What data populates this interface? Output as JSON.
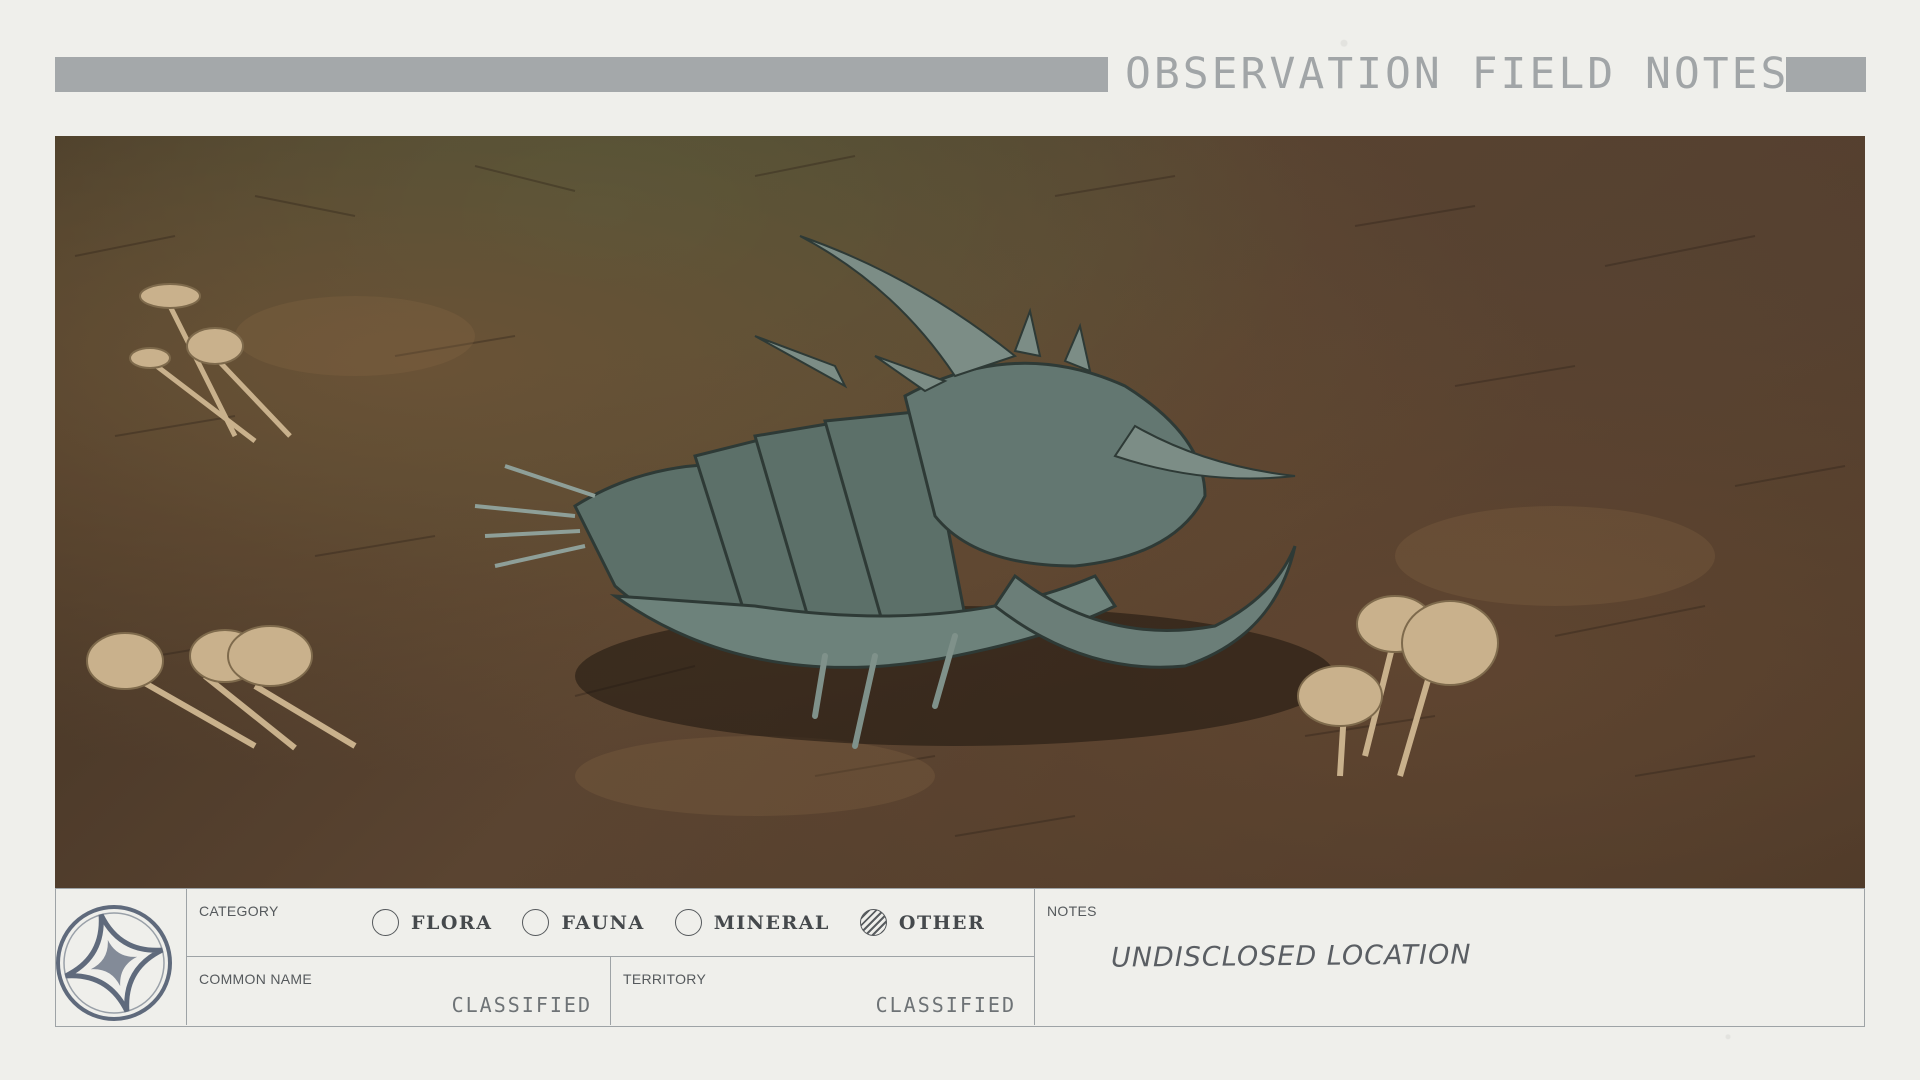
{
  "header": {
    "title": "OBSERVATION FIELD NOTES"
  },
  "photo": {
    "subject": ""
  },
  "info_panel": {
    "logo_icon": "four-point-star-emblem-icon",
    "category": {
      "label": "CATEGORY",
      "options": [
        {
          "label": "FLORA",
          "selected": false
        },
        {
          "label": "FAUNA",
          "selected": false
        },
        {
          "label": "MINERAL",
          "selected": false
        },
        {
          "label": "OTHER",
          "selected": true
        }
      ]
    },
    "common_name": {
      "label": "COMMON NAME",
      "value": "CLASSIFIED"
    },
    "territory": {
      "label": "TERRITORY",
      "value": "CLASSIFIED"
    },
    "notes": {
      "label": "NOTES",
      "value": "UNDISCLOSED LOCATION"
    }
  },
  "colors": {
    "paper": "#efefeb",
    "rule": "#9ea3a6",
    "header_bar": "#a4a8aa"
  }
}
